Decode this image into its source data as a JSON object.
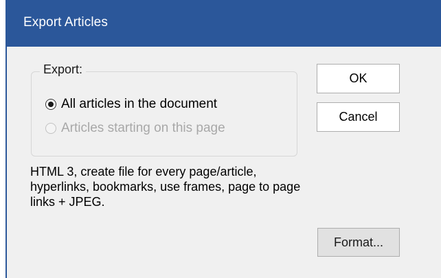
{
  "window": {
    "title": "Export Articles",
    "title_bar_color": "#2b579a"
  },
  "export_group": {
    "legend": "Export:",
    "options": [
      {
        "label": "All articles in the document",
        "selected": true,
        "enabled": true
      },
      {
        "label": "Articles starting on this page",
        "selected": false,
        "enabled": false
      }
    ]
  },
  "description": "HTML 3, create file for every page/article, hyperlinks, bookmarks, use frames, page to page links + JPEG.",
  "buttons": {
    "ok": "OK",
    "cancel": "Cancel",
    "format": "Format..."
  }
}
